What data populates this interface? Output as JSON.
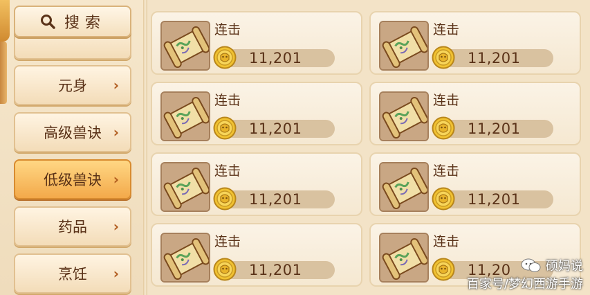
{
  "search": {
    "label": "搜索",
    "icon": "search-icon"
  },
  "categories": [
    {
      "label": "",
      "partial": true
    },
    {
      "label": "元身",
      "chevron": "›"
    },
    {
      "label": "高级兽诀",
      "chevron": "›"
    },
    {
      "label": "低级兽诀",
      "chevron": "›",
      "active": true
    },
    {
      "label": "药品",
      "chevron": "›"
    },
    {
      "label": "烹饪",
      "chevron": "›"
    }
  ],
  "items": [
    {
      "name": "连击",
      "price": "11,201",
      "icon": "skill-scroll-icon"
    },
    {
      "name": "连击",
      "price": "11,201",
      "icon": "skill-scroll-icon"
    },
    {
      "name": "连击",
      "price": "11,201",
      "icon": "skill-scroll-icon"
    },
    {
      "name": "连击",
      "price": "11,201",
      "icon": "skill-scroll-icon"
    },
    {
      "name": "连击",
      "price": "11,201",
      "icon": "skill-scroll-icon"
    },
    {
      "name": "连击",
      "price": "11,201",
      "icon": "skill-scroll-icon"
    },
    {
      "name": "连击",
      "price": "11,201",
      "icon": "skill-scroll-icon"
    },
    {
      "name": "连击",
      "price": "11,20",
      "icon": "skill-scroll-icon"
    }
  ],
  "watermark": {
    "name": "硕妈说",
    "source": "百家号/梦幻西游手游"
  },
  "colors": {
    "text": "#5a3218",
    "active_category": "#f3a94a",
    "card_bg": "#fbf3e6",
    "price_bar": "#d9c2a0",
    "coin": "#f1c231"
  }
}
